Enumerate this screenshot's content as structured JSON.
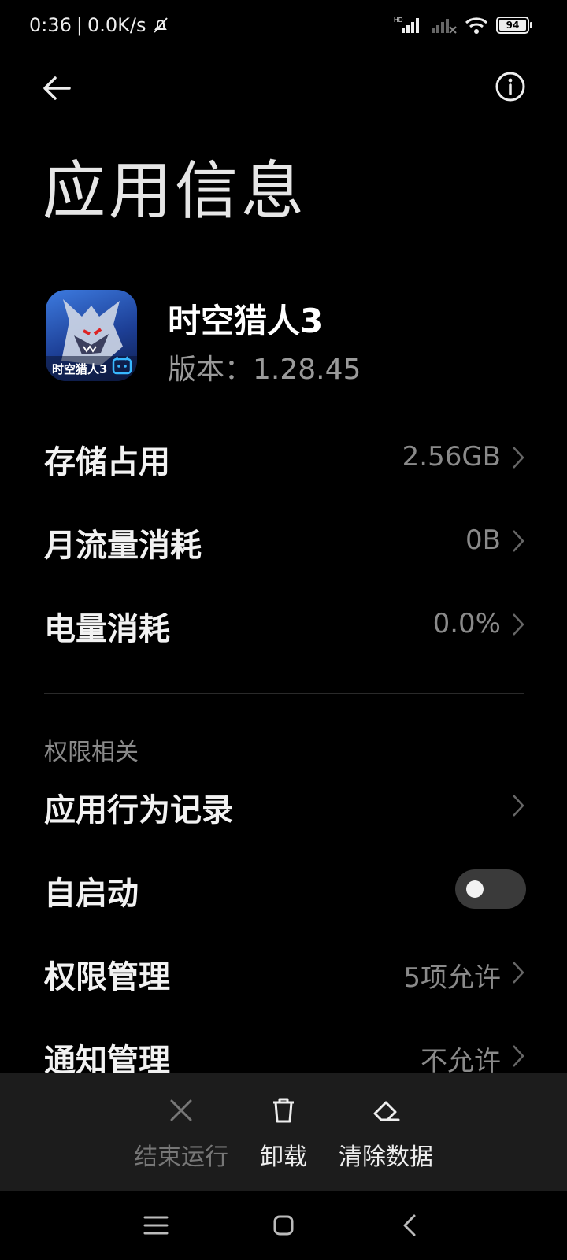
{
  "status_bar": {
    "time": "0:36",
    "speed": "0.0K/s",
    "battery": "94",
    "network_label": "HD"
  },
  "header": {
    "title": "应用信息"
  },
  "app": {
    "name": "时空猎人3",
    "version": "版本：1.28.45",
    "icon_text": "时空猎人3"
  },
  "usage": [
    {
      "label": "存储占用",
      "value": "2.56GB"
    },
    {
      "label": "月流量消耗",
      "value": "0B"
    },
    {
      "label": "电量消耗",
      "value": "0.0%"
    }
  ],
  "permissions": {
    "section_title": "权限相关",
    "items": [
      {
        "label": "应用行为记录",
        "value": ""
      },
      {
        "label": "自启动",
        "toggle_on": false
      },
      {
        "label": "权限管理",
        "value": "5项允许"
      },
      {
        "label": "通知管理",
        "value": "不允许"
      }
    ]
  },
  "actions": [
    {
      "label": "结束运行",
      "icon": "close-icon",
      "enabled": false
    },
    {
      "label": "卸载",
      "icon": "trash-icon",
      "enabled": true
    },
    {
      "label": "清除数据",
      "icon": "eraser-icon",
      "enabled": true
    }
  ],
  "colors": {
    "background": "#000000",
    "action_bar": "#1c1c1c",
    "secondary_text": "#8a8a8a",
    "disabled_text": "#777777"
  }
}
